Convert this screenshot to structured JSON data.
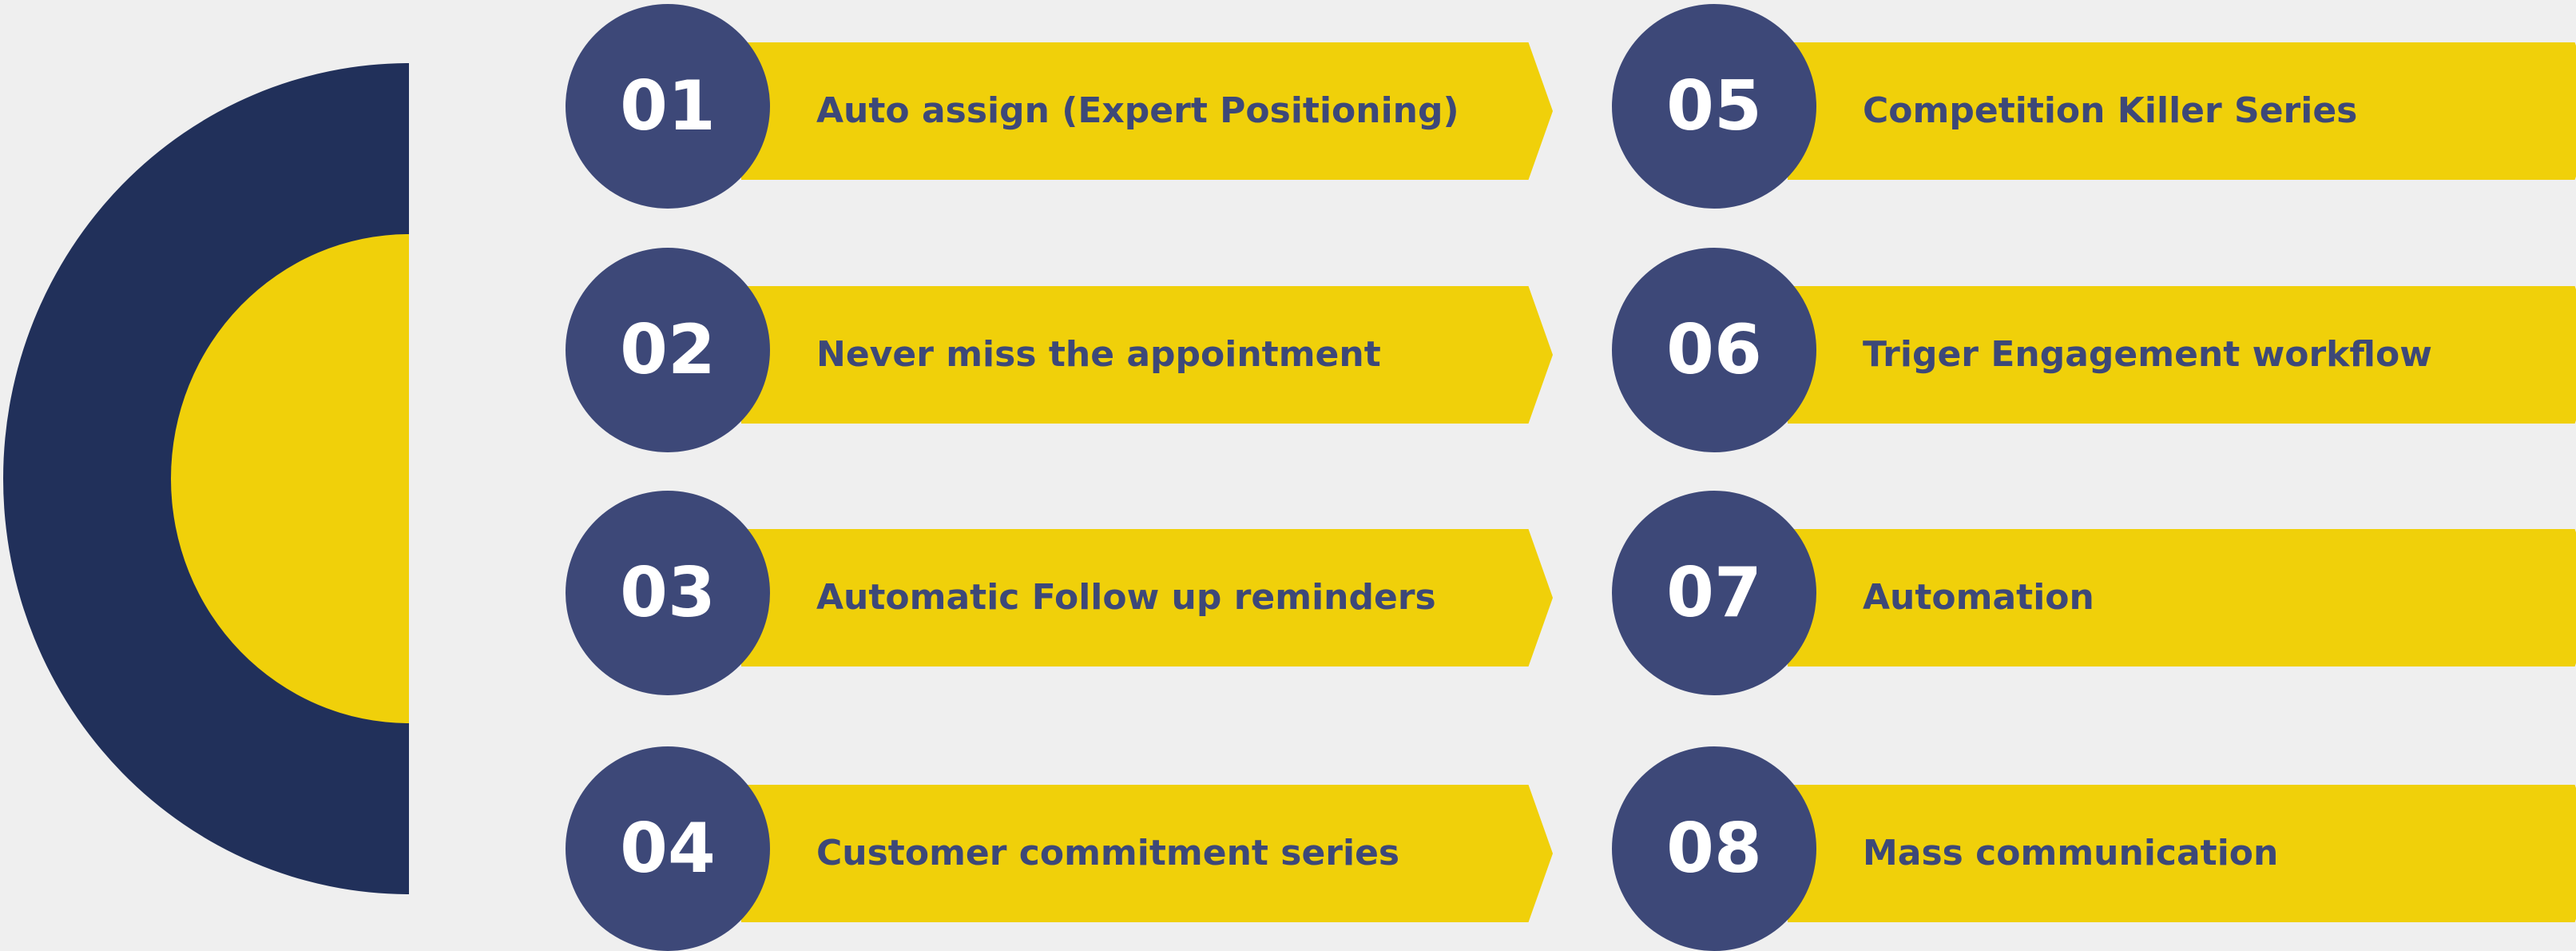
{
  "colors": {
    "background": "#efefef",
    "navy": "#21305a",
    "yellow": "#f0d00a",
    "circle": "#3d4878",
    "text": "#3d4878",
    "number": "#ffffff"
  },
  "items": [
    {
      "number": "01",
      "label": "Auto assign (Expert Positioning)"
    },
    {
      "number": "02",
      "label": "Never miss the appointment"
    },
    {
      "number": "03",
      "label": "Automatic Follow up reminders"
    },
    {
      "number": "04",
      "label": "Customer commitment series"
    },
    {
      "number": "05",
      "label": "Competition Killer Series"
    },
    {
      "number": "06",
      "label": "Triger Engagement workflow"
    },
    {
      "number": "07",
      "label": "Automation"
    },
    {
      "number": "08",
      "label": "Mass communication"
    }
  ]
}
